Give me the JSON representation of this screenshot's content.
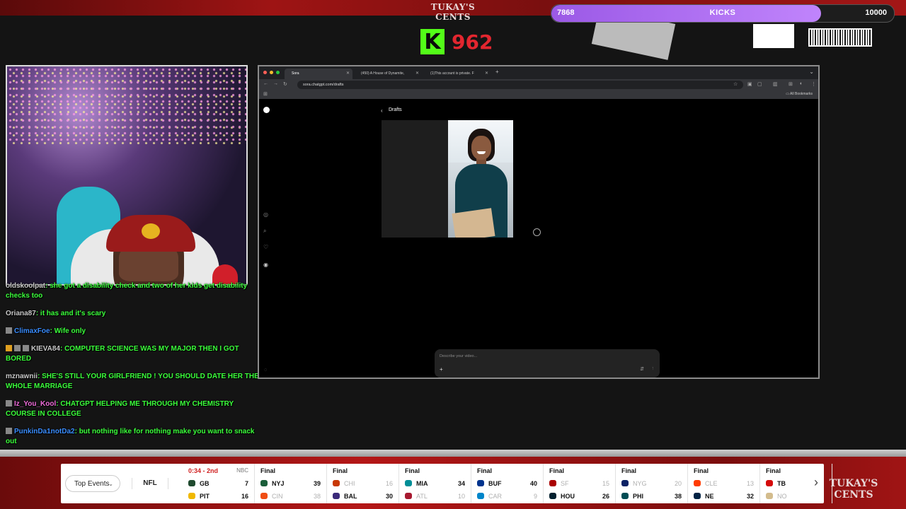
{
  "header": {
    "logo_text": "TUKAY'S CENTS",
    "goal": {
      "current": "7868",
      "label": "KICKS",
      "target": "10000",
      "progress": 0.7868
    },
    "kick_counter": {
      "icon": "K",
      "count": "962"
    },
    "advisory_text": "PARENTAL ADVISORY EXPLICIT CONTENT"
  },
  "chat": [
    {
      "user": "oldskoolpat",
      "text": "she got a disability check and two of her kids get disability checks too",
      "user_color": "gray",
      "badges": 0
    },
    {
      "user": "Oriana87",
      "text": "it has and it's scary",
      "user_color": "gray",
      "badges": 0
    },
    {
      "user": "ClimaxFoe",
      "text": "Wife only",
      "user_color": "blue",
      "badges": 1
    },
    {
      "user": "KIEVA84",
      "text": "COMPUTER SCIENCE WAS MY MAJOR THEN I GOT BORED",
      "user_color": "gray",
      "badges": 3
    },
    {
      "user": "mznawnii",
      "text": "SHE'S STILL YOUR GIRLFRIEND ! YOU SHOULD DATE HER THE WHOLE MARRIAGE",
      "user_color": "gray",
      "badges": 0
    },
    {
      "user": "Iz_You_Kool",
      "text": "CHATGPT HELPING ME THROUGH MY CHEMISTRY COURSE IN COLLEGE",
      "user_color": "pink",
      "badges": 1
    },
    {
      "user": "PunkinDa1notDa2",
      "text": "but nothing like for nothing make you want to snack out",
      "user_color": "blue",
      "badges": 1
    }
  ],
  "browser": {
    "tabs": [
      {
        "label": "Sora",
        "active": true
      },
      {
        "label": "(450) A House of Dynamite,",
        "active": false
      },
      {
        "label": "(1)This account is private. F",
        "active": false
      }
    ],
    "url": "sora.chatgpt.com/drafts",
    "bookmarks_label": "All Bookmarks",
    "sora": {
      "drafts_title": "Drafts",
      "prompt_placeholder": "Describe your video..."
    }
  },
  "ticker": {
    "filter_label": "Top Events",
    "league": "NFL",
    "games": [
      {
        "status": "0:34 - 2nd",
        "live": true,
        "network": "NBC",
        "team1": {
          "abbr": "GB",
          "score": "7",
          "color": "#1f4a2e",
          "lost": false
        },
        "team2": {
          "abbr": "PIT",
          "score": "16",
          "color": "#f0b800",
          "lost": false
        }
      },
      {
        "status": "Final",
        "live": false,
        "network": "",
        "team1": {
          "abbr": "NYJ",
          "score": "39",
          "color": "#1a5e3a",
          "lost": false
        },
        "team2": {
          "abbr": "CIN",
          "score": "38",
          "color": "#f04e14",
          "lost": true
        }
      },
      {
        "status": "Final",
        "live": false,
        "network": "",
        "team1": {
          "abbr": "CHI",
          "score": "16",
          "color": "#c83803",
          "lost": true
        },
        "team2": {
          "abbr": "BAL",
          "score": "30",
          "color": "#3b2a7a",
          "lost": false
        }
      },
      {
        "status": "Final",
        "live": false,
        "network": "",
        "team1": {
          "abbr": "MIA",
          "score": "34",
          "color": "#008e97",
          "lost": false
        },
        "team2": {
          "abbr": "ATL",
          "score": "10",
          "color": "#a71930",
          "lost": true
        }
      },
      {
        "status": "Final",
        "live": false,
        "network": "",
        "team1": {
          "abbr": "BUF",
          "score": "40",
          "color": "#00338d",
          "lost": false
        },
        "team2": {
          "abbr": "CAR",
          "score": "9",
          "color": "#0085ca",
          "lost": true
        }
      },
      {
        "status": "Final",
        "live": false,
        "network": "",
        "team1": {
          "abbr": "SF",
          "score": "15",
          "color": "#aa0000",
          "lost": true
        },
        "team2": {
          "abbr": "HOU",
          "score": "26",
          "color": "#03202f",
          "lost": false
        }
      },
      {
        "status": "Final",
        "live": false,
        "network": "",
        "team1": {
          "abbr": "NYG",
          "score": "20",
          "color": "#0b2265",
          "lost": true
        },
        "team2": {
          "abbr": "PHI",
          "score": "38",
          "color": "#004c54",
          "lost": false
        }
      },
      {
        "status": "Final",
        "live": false,
        "network": "",
        "team1": {
          "abbr": "CLE",
          "score": "13",
          "color": "#ff3c00",
          "lost": true
        },
        "team2": {
          "abbr": "NE",
          "score": "32",
          "color": "#002244",
          "lost": false
        }
      },
      {
        "status": "Final",
        "live": false,
        "network": "",
        "team1": {
          "abbr": "TB",
          "score": "",
          "color": "#d50a0a",
          "lost": false
        },
        "team2": {
          "abbr": "NO",
          "score": "",
          "color": "#d3bc8d",
          "lost": true
        }
      }
    ]
  },
  "footer_logo": "TUKAY'S CENTS"
}
